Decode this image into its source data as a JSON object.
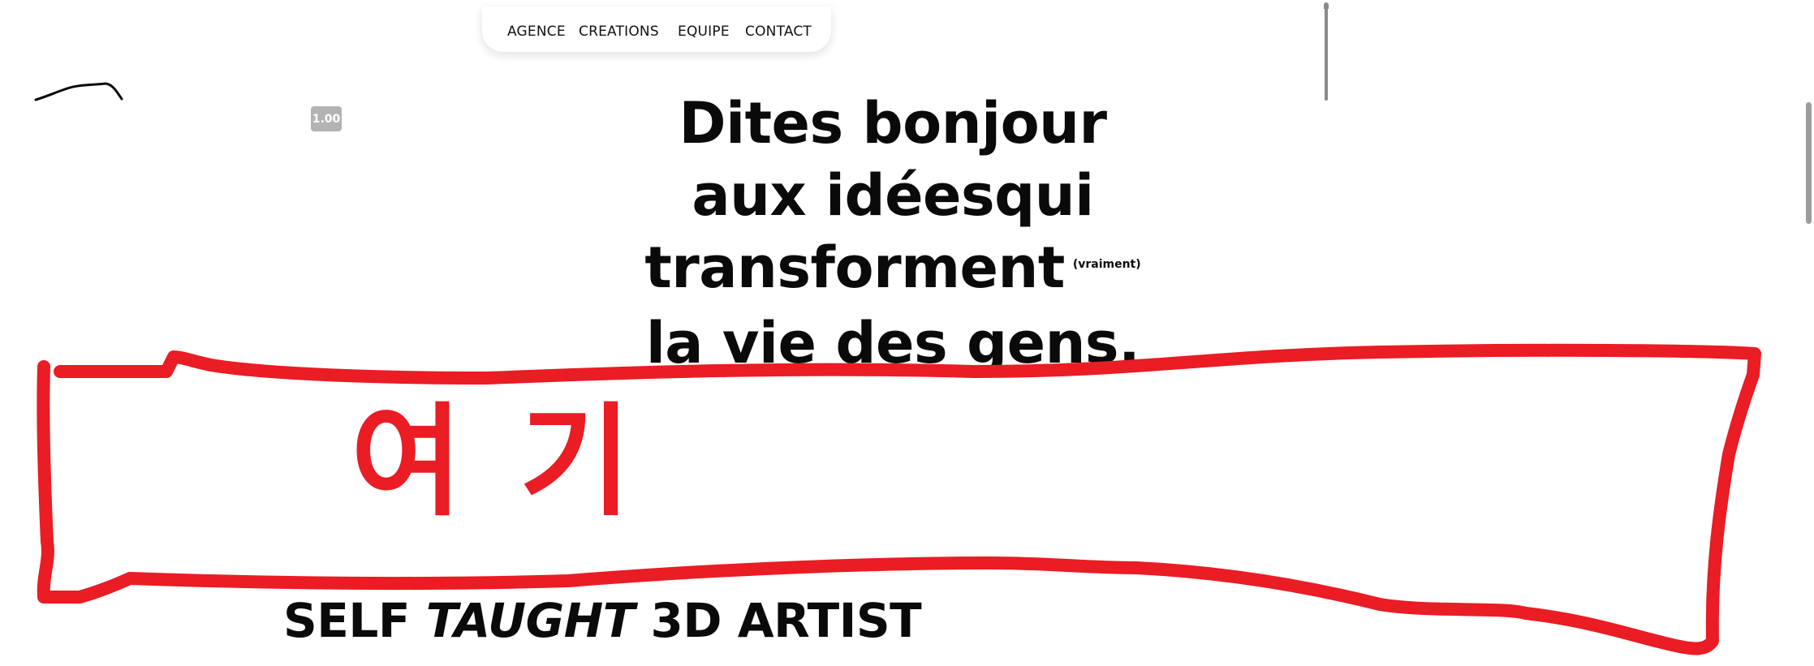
{
  "nav": {
    "items": [
      {
        "label": "AGENCE"
      },
      {
        "label": "CREATIONS"
      },
      {
        "label": "EQUIPE"
      },
      {
        "label": "CONTACT"
      }
    ]
  },
  "fps_badge": {
    "value": "1.00"
  },
  "hero": {
    "lines": [
      "Dites bonjour",
      "aux idéesqui",
      "transforment",
      "la vie des gens."
    ],
    "aside": "(vraiment)"
  },
  "subtitle": {
    "part1": "SELF",
    "part2_italic": "TAUGHT",
    "part3": "3D ARTIST"
  },
  "annotation": {
    "text": "여기",
    "color": "#ea1c24"
  },
  "scrollbar": {
    "position": 0.0
  }
}
